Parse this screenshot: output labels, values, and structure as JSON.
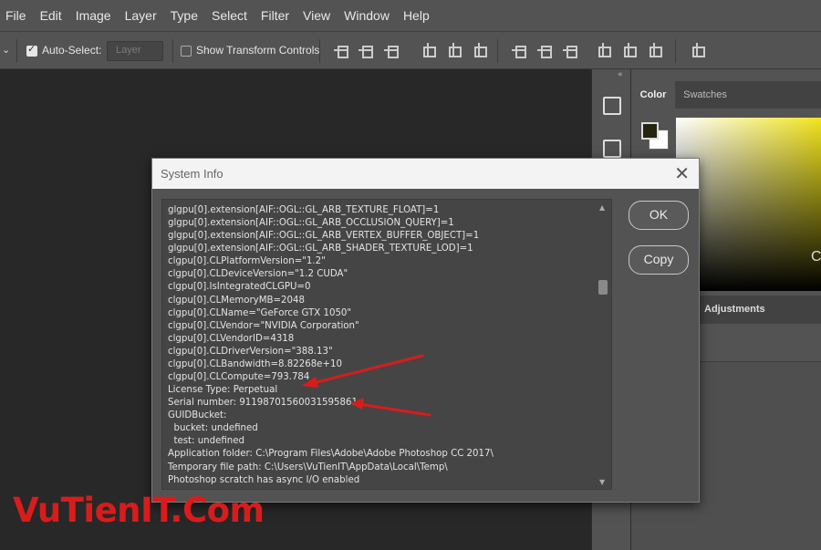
{
  "menu": {
    "items": [
      "File",
      "Edit",
      "Image",
      "Layer",
      "Type",
      "Select",
      "Filter",
      "View",
      "Window",
      "Help"
    ]
  },
  "options_bar": {
    "tool_dropdown_icon": "chevron-down-icon",
    "auto_select_label": "Auto-Select:",
    "auto_select_checked": true,
    "auto_select_target": "Layer",
    "show_transform_label": "Show Transform Controls",
    "show_transform_checked": false,
    "align_icons": [
      "align-top-icon",
      "align-vertical-center-icon",
      "align-bottom-icon",
      "align-left-icon",
      "align-horizontal-center-icon",
      "align-right-icon",
      "distribute-top-icon",
      "distribute-vertical-center-icon",
      "distribute-bottom-icon",
      "distribute-left-icon",
      "distribute-horizontal-center-icon",
      "distribute-right-icon",
      "auto-align-icon"
    ]
  },
  "right_panel": {
    "collapse_icon": "double-chevron-icon",
    "tabs": [
      {
        "label": "Color",
        "active": true
      },
      {
        "label": "Swatches",
        "active": false
      }
    ],
    "foreground_color": "#26250f",
    "background_color": "#ffffff",
    "color_field_hue": "#f2e41e",
    "field_marker": "C",
    "adjustments_tab": "Adjustments",
    "partial_label": "s"
  },
  "tool_strip": {
    "icons": [
      "history-icon",
      "properties-icon"
    ]
  },
  "dialog": {
    "title": "System Info",
    "close_icon": "close-icon",
    "ok_label": "OK",
    "copy_label": "Copy",
    "lines": [
      "glgpu[0].extension[AIF::OGL::GL_ARB_TEXTURE_FLOAT]=1",
      "glgpu[0].extension[AIF::OGL::GL_ARB_OCCLUSION_QUERY]=1",
      "glgpu[0].extension[AIF::OGL::GL_ARB_VERTEX_BUFFER_OBJECT]=1",
      "glgpu[0].extension[AIF::OGL::GL_ARB_SHADER_TEXTURE_LOD]=1",
      "clgpu[0].CLPlatformVersion=\"1.2\"",
      "clgpu[0].CLDeviceVersion=\"1.2 CUDA\"",
      "clgpu[0].IsIntegratedCLGPU=0",
      "clgpu[0].CLMemoryMB=2048",
      "clgpu[0].CLName=\"GeForce GTX 1050\"",
      "clgpu[0].CLVendor=\"NVIDIA Corporation\"",
      "clgpu[0].CLVendorID=4318",
      "clgpu[0].CLDriverVersion=\"388.13\"",
      "clgpu[0].CLBandwidth=8.82268e+10",
      "clgpu[0].CLCompute=793.784",
      "License Type: Perpetual",
      "Serial number: 91198701560031595861",
      "GUIDBucket:",
      "  bucket: undefined",
      "  test: undefined",
      "Application folder: C:\\Program Files\\Adobe\\Adobe Photoshop CC 2017\\",
      "Temporary file path: C:\\Users\\VuTienIT\\AppData\\Local\\Temp\\",
      "Photoshop scratch has async I/O enabled"
    ],
    "scroll_up_icon": "scroll-up-icon",
    "scroll_down_icon": "scroll-down-icon",
    "scroll_position": 0.27
  },
  "annotation_color": "#d81c1c",
  "watermark": "VuTienIT.Com"
}
